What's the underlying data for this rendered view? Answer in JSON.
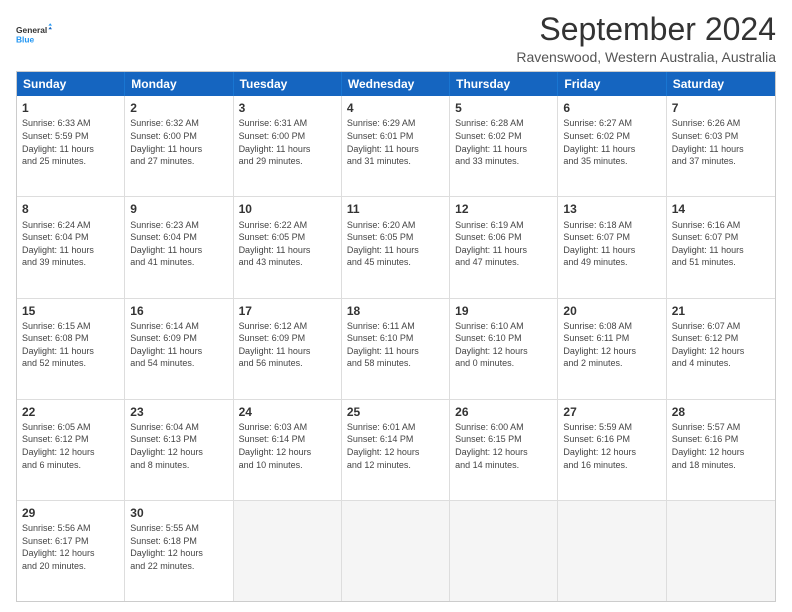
{
  "logo": {
    "line1": "General",
    "line2": "Blue"
  },
  "title": "September 2024",
  "subtitle": "Ravenswood, Western Australia, Australia",
  "header": {
    "days": [
      "Sunday",
      "Monday",
      "Tuesday",
      "Wednesday",
      "Thursday",
      "Friday",
      "Saturday"
    ]
  },
  "weeks": [
    {
      "cells": [
        {
          "day": "",
          "info": ""
        },
        {
          "day": "2",
          "info": "Sunrise: 6:32 AM\nSunset: 6:00 PM\nDaylight: 11 hours\nand 27 minutes."
        },
        {
          "day": "3",
          "info": "Sunrise: 6:31 AM\nSunset: 6:00 PM\nDaylight: 11 hours\nand 29 minutes."
        },
        {
          "day": "4",
          "info": "Sunrise: 6:29 AM\nSunset: 6:01 PM\nDaylight: 11 hours\nand 31 minutes."
        },
        {
          "day": "5",
          "info": "Sunrise: 6:28 AM\nSunset: 6:02 PM\nDaylight: 11 hours\nand 33 minutes."
        },
        {
          "day": "6",
          "info": "Sunrise: 6:27 AM\nSunset: 6:02 PM\nDaylight: 11 hours\nand 35 minutes."
        },
        {
          "day": "7",
          "info": "Sunrise: 6:26 AM\nSunset: 6:03 PM\nDaylight: 11 hours\nand 37 minutes."
        }
      ],
      "firstDay": 1
    },
    {
      "cells": [
        {
          "day": "1",
          "info": "Sunrise: 6:33 AM\nSunset: 5:59 PM\nDaylight: 11 hours\nand 25 minutes."
        },
        {
          "day": "2",
          "info": "Sunrise: 6:32 AM\nSunset: 6:00 PM\nDaylight: 11 hours\nand 27 minutes."
        },
        {
          "day": "3",
          "info": "Sunrise: 6:31 AM\nSunset: 6:00 PM\nDaylight: 11 hours\nand 29 minutes."
        },
        {
          "day": "4",
          "info": "Sunrise: 6:29 AM\nSunset: 6:01 PM\nDaylight: 11 hours\nand 31 minutes."
        },
        {
          "day": "5",
          "info": "Sunrise: 6:28 AM\nSunset: 6:02 PM\nDaylight: 11 hours\nand 33 minutes."
        },
        {
          "day": "6",
          "info": "Sunrise: 6:27 AM\nSunset: 6:02 PM\nDaylight: 11 hours\nand 35 minutes."
        },
        {
          "day": "7",
          "info": "Sunrise: 6:26 AM\nSunset: 6:03 PM\nDaylight: 11 hours\nand 37 minutes."
        }
      ]
    },
    {
      "cells": [
        {
          "day": "8",
          "info": "Sunrise: 6:24 AM\nSunset: 6:04 PM\nDaylight: 11 hours\nand 39 minutes."
        },
        {
          "day": "9",
          "info": "Sunrise: 6:23 AM\nSunset: 6:04 PM\nDaylight: 11 hours\nand 41 minutes."
        },
        {
          "day": "10",
          "info": "Sunrise: 6:22 AM\nSunset: 6:05 PM\nDaylight: 11 hours\nand 43 minutes."
        },
        {
          "day": "11",
          "info": "Sunrise: 6:20 AM\nSunset: 6:05 PM\nDaylight: 11 hours\nand 45 minutes."
        },
        {
          "day": "12",
          "info": "Sunrise: 6:19 AM\nSunset: 6:06 PM\nDaylight: 11 hours\nand 47 minutes."
        },
        {
          "day": "13",
          "info": "Sunrise: 6:18 AM\nSunset: 6:07 PM\nDaylight: 11 hours\nand 49 minutes."
        },
        {
          "day": "14",
          "info": "Sunrise: 6:16 AM\nSunset: 6:07 PM\nDaylight: 11 hours\nand 51 minutes."
        }
      ]
    },
    {
      "cells": [
        {
          "day": "15",
          "info": "Sunrise: 6:15 AM\nSunset: 6:08 PM\nDaylight: 11 hours\nand 52 minutes."
        },
        {
          "day": "16",
          "info": "Sunrise: 6:14 AM\nSunset: 6:09 PM\nDaylight: 11 hours\nand 54 minutes."
        },
        {
          "day": "17",
          "info": "Sunrise: 6:12 AM\nSunset: 6:09 PM\nDaylight: 11 hours\nand 56 minutes."
        },
        {
          "day": "18",
          "info": "Sunrise: 6:11 AM\nSunset: 6:10 PM\nDaylight: 11 hours\nand 58 minutes."
        },
        {
          "day": "19",
          "info": "Sunrise: 6:10 AM\nSunset: 6:10 PM\nDaylight: 12 hours\nand 0 minutes."
        },
        {
          "day": "20",
          "info": "Sunrise: 6:08 AM\nSunset: 6:11 PM\nDaylight: 12 hours\nand 2 minutes."
        },
        {
          "day": "21",
          "info": "Sunrise: 6:07 AM\nSunset: 6:12 PM\nDaylight: 12 hours\nand 4 minutes."
        }
      ]
    },
    {
      "cells": [
        {
          "day": "22",
          "info": "Sunrise: 6:05 AM\nSunset: 6:12 PM\nDaylight: 12 hours\nand 6 minutes."
        },
        {
          "day": "23",
          "info": "Sunrise: 6:04 AM\nSunset: 6:13 PM\nDaylight: 12 hours\nand 8 minutes."
        },
        {
          "day": "24",
          "info": "Sunrise: 6:03 AM\nSunset: 6:14 PM\nDaylight: 12 hours\nand 10 minutes."
        },
        {
          "day": "25",
          "info": "Sunrise: 6:01 AM\nSunset: 6:14 PM\nDaylight: 12 hours\nand 12 minutes."
        },
        {
          "day": "26",
          "info": "Sunrise: 6:00 AM\nSunset: 6:15 PM\nDaylight: 12 hours\nand 14 minutes."
        },
        {
          "day": "27",
          "info": "Sunrise: 5:59 AM\nSunset: 6:16 PM\nDaylight: 12 hours\nand 16 minutes."
        },
        {
          "day": "28",
          "info": "Sunrise: 5:57 AM\nSunset: 6:16 PM\nDaylight: 12 hours\nand 18 minutes."
        }
      ]
    },
    {
      "cells": [
        {
          "day": "29",
          "info": "Sunrise: 5:56 AM\nSunset: 6:17 PM\nDaylight: 12 hours\nand 20 minutes."
        },
        {
          "day": "30",
          "info": "Sunrise: 5:55 AM\nSunset: 6:18 PM\nDaylight: 12 hours\nand 22 minutes."
        },
        {
          "day": "",
          "info": ""
        },
        {
          "day": "",
          "info": ""
        },
        {
          "day": "",
          "info": ""
        },
        {
          "day": "",
          "info": ""
        },
        {
          "day": "",
          "info": ""
        }
      ]
    }
  ]
}
